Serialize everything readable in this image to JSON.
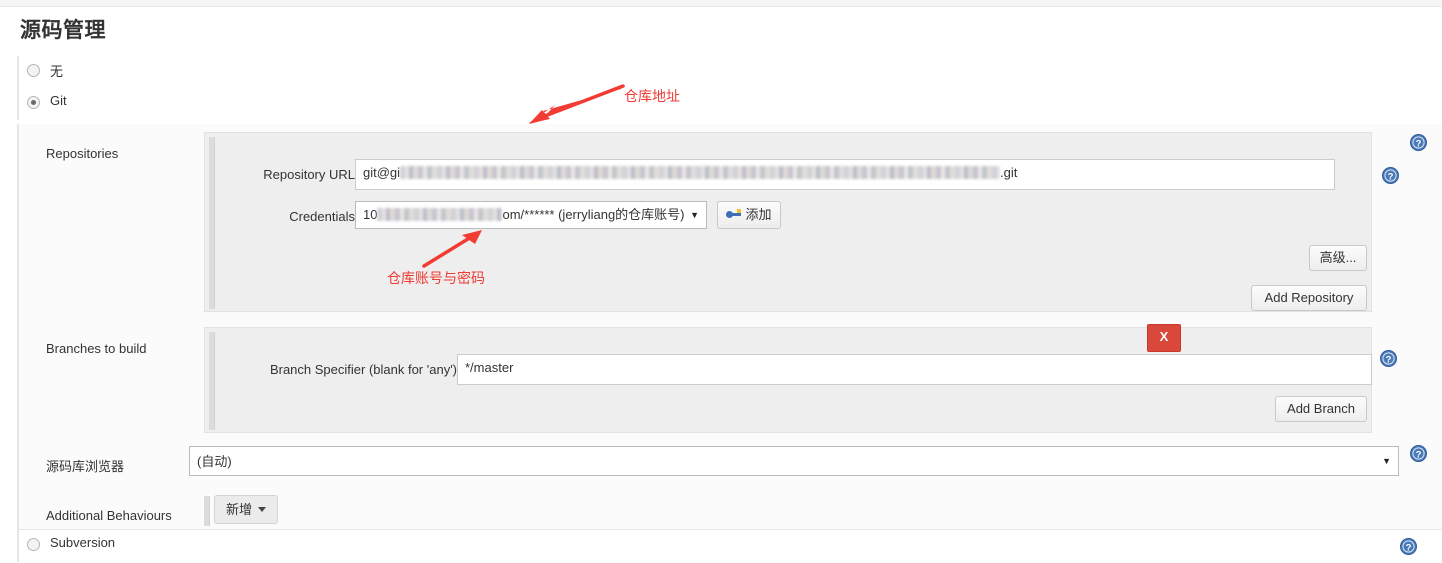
{
  "page": {
    "title": "源码管理"
  },
  "scm_options": [
    {
      "label": "无",
      "selected": false
    },
    {
      "label": "Git",
      "selected": true
    },
    {
      "label": "Subversion",
      "selected": false
    }
  ],
  "git": {
    "repositories": {
      "label": "Repositories",
      "repository_url": {
        "label": "Repository URL",
        "value_prefix": "git@gi",
        "value_redacted": true,
        "value_suffix": ".git"
      },
      "credentials": {
        "label": "Credentials",
        "value_prefix": "10",
        "value_redacted": true,
        "value_suffix": "om/****** (jerryliang的仓库账号)"
      },
      "add_credentials_button": "添加",
      "advanced_button": "高级...",
      "add_repository_button": "Add Repository"
    },
    "branches": {
      "label": "Branches to build",
      "branch_specifier": {
        "label": "Branch Specifier (blank for 'any')",
        "value": "*/master"
      },
      "delete_button": "X",
      "add_branch_button": "Add Branch"
    },
    "repository_browser": {
      "label": "源码库浏览器",
      "value": "(自动)"
    },
    "additional_behaviours": {
      "label": "Additional Behaviours",
      "add_button": "新增"
    }
  },
  "annotations": [
    {
      "text": "仓库地址"
    },
    {
      "text": "仓库账号与密码"
    }
  ],
  "colors": {
    "annotation_red": "#ef3b33",
    "delete_red": "#d9483b",
    "help_blue": "#2f5c9e"
  }
}
